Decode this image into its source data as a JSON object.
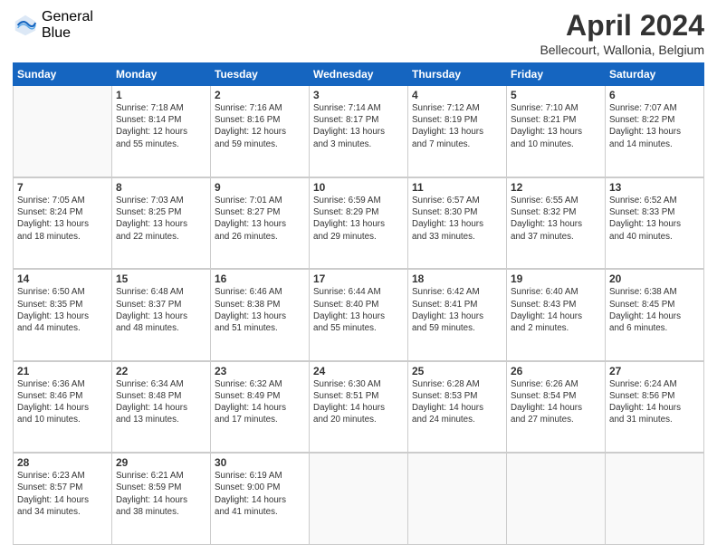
{
  "header": {
    "logo_general": "General",
    "logo_blue": "Blue",
    "month_title": "April 2024",
    "location": "Bellecourt, Wallonia, Belgium"
  },
  "days_of_week": [
    "Sunday",
    "Monday",
    "Tuesday",
    "Wednesday",
    "Thursday",
    "Friday",
    "Saturday"
  ],
  "weeks": [
    [
      {
        "day": "",
        "info": ""
      },
      {
        "day": "1",
        "info": "Sunrise: 7:18 AM\nSunset: 8:14 PM\nDaylight: 12 hours\nand 55 minutes."
      },
      {
        "day": "2",
        "info": "Sunrise: 7:16 AM\nSunset: 8:16 PM\nDaylight: 12 hours\nand 59 minutes."
      },
      {
        "day": "3",
        "info": "Sunrise: 7:14 AM\nSunset: 8:17 PM\nDaylight: 13 hours\nand 3 minutes."
      },
      {
        "day": "4",
        "info": "Sunrise: 7:12 AM\nSunset: 8:19 PM\nDaylight: 13 hours\nand 7 minutes."
      },
      {
        "day": "5",
        "info": "Sunrise: 7:10 AM\nSunset: 8:21 PM\nDaylight: 13 hours\nand 10 minutes."
      },
      {
        "day": "6",
        "info": "Sunrise: 7:07 AM\nSunset: 8:22 PM\nDaylight: 13 hours\nand 14 minutes."
      }
    ],
    [
      {
        "day": "7",
        "info": "Sunrise: 7:05 AM\nSunset: 8:24 PM\nDaylight: 13 hours\nand 18 minutes."
      },
      {
        "day": "8",
        "info": "Sunrise: 7:03 AM\nSunset: 8:25 PM\nDaylight: 13 hours\nand 22 minutes."
      },
      {
        "day": "9",
        "info": "Sunrise: 7:01 AM\nSunset: 8:27 PM\nDaylight: 13 hours\nand 26 minutes."
      },
      {
        "day": "10",
        "info": "Sunrise: 6:59 AM\nSunset: 8:29 PM\nDaylight: 13 hours\nand 29 minutes."
      },
      {
        "day": "11",
        "info": "Sunrise: 6:57 AM\nSunset: 8:30 PM\nDaylight: 13 hours\nand 33 minutes."
      },
      {
        "day": "12",
        "info": "Sunrise: 6:55 AM\nSunset: 8:32 PM\nDaylight: 13 hours\nand 37 minutes."
      },
      {
        "day": "13",
        "info": "Sunrise: 6:52 AM\nSunset: 8:33 PM\nDaylight: 13 hours\nand 40 minutes."
      }
    ],
    [
      {
        "day": "14",
        "info": "Sunrise: 6:50 AM\nSunset: 8:35 PM\nDaylight: 13 hours\nand 44 minutes."
      },
      {
        "day": "15",
        "info": "Sunrise: 6:48 AM\nSunset: 8:37 PM\nDaylight: 13 hours\nand 48 minutes."
      },
      {
        "day": "16",
        "info": "Sunrise: 6:46 AM\nSunset: 8:38 PM\nDaylight: 13 hours\nand 51 minutes."
      },
      {
        "day": "17",
        "info": "Sunrise: 6:44 AM\nSunset: 8:40 PM\nDaylight: 13 hours\nand 55 minutes."
      },
      {
        "day": "18",
        "info": "Sunrise: 6:42 AM\nSunset: 8:41 PM\nDaylight: 13 hours\nand 59 minutes."
      },
      {
        "day": "19",
        "info": "Sunrise: 6:40 AM\nSunset: 8:43 PM\nDaylight: 14 hours\nand 2 minutes."
      },
      {
        "day": "20",
        "info": "Sunrise: 6:38 AM\nSunset: 8:45 PM\nDaylight: 14 hours\nand 6 minutes."
      }
    ],
    [
      {
        "day": "21",
        "info": "Sunrise: 6:36 AM\nSunset: 8:46 PM\nDaylight: 14 hours\nand 10 minutes."
      },
      {
        "day": "22",
        "info": "Sunrise: 6:34 AM\nSunset: 8:48 PM\nDaylight: 14 hours\nand 13 minutes."
      },
      {
        "day": "23",
        "info": "Sunrise: 6:32 AM\nSunset: 8:49 PM\nDaylight: 14 hours\nand 17 minutes."
      },
      {
        "day": "24",
        "info": "Sunrise: 6:30 AM\nSunset: 8:51 PM\nDaylight: 14 hours\nand 20 minutes."
      },
      {
        "day": "25",
        "info": "Sunrise: 6:28 AM\nSunset: 8:53 PM\nDaylight: 14 hours\nand 24 minutes."
      },
      {
        "day": "26",
        "info": "Sunrise: 6:26 AM\nSunset: 8:54 PM\nDaylight: 14 hours\nand 27 minutes."
      },
      {
        "day": "27",
        "info": "Sunrise: 6:24 AM\nSunset: 8:56 PM\nDaylight: 14 hours\nand 31 minutes."
      }
    ],
    [
      {
        "day": "28",
        "info": "Sunrise: 6:23 AM\nSunset: 8:57 PM\nDaylight: 14 hours\nand 34 minutes."
      },
      {
        "day": "29",
        "info": "Sunrise: 6:21 AM\nSunset: 8:59 PM\nDaylight: 14 hours\nand 38 minutes."
      },
      {
        "day": "30",
        "info": "Sunrise: 6:19 AM\nSunset: 9:00 PM\nDaylight: 14 hours\nand 41 minutes."
      },
      {
        "day": "",
        "info": ""
      },
      {
        "day": "",
        "info": ""
      },
      {
        "day": "",
        "info": ""
      },
      {
        "day": "",
        "info": ""
      }
    ]
  ]
}
